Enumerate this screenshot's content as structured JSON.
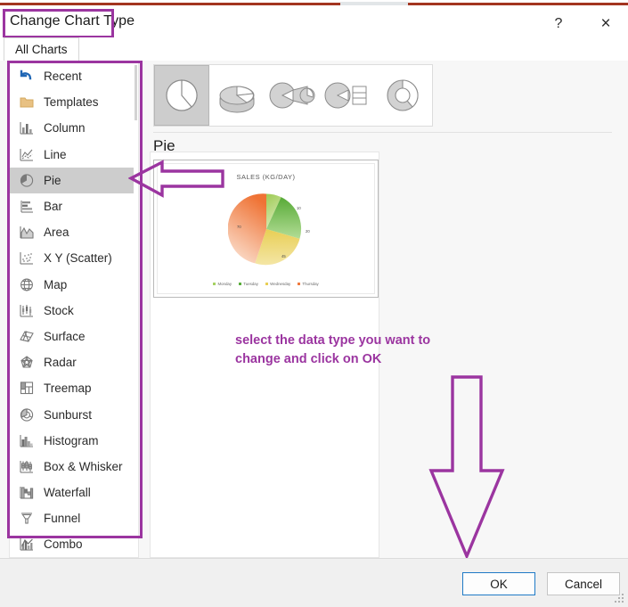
{
  "window": {
    "title": "Change Chart Type",
    "help_label": "?",
    "close_label": "×"
  },
  "tabs": [
    {
      "label": "All Charts",
      "active": true
    }
  ],
  "sidebar": {
    "items": [
      {
        "label": "Recent",
        "icon": "undo-arrow-icon",
        "selected": false
      },
      {
        "label": "Templates",
        "icon": "folder-icon",
        "selected": false
      },
      {
        "label": "Column",
        "icon": "column-chart-icon",
        "selected": false
      },
      {
        "label": "Line",
        "icon": "line-chart-icon",
        "selected": false
      },
      {
        "label": "Pie",
        "icon": "pie-chart-icon",
        "selected": true
      },
      {
        "label": "Bar",
        "icon": "bar-chart-icon",
        "selected": false
      },
      {
        "label": "Area",
        "icon": "area-chart-icon",
        "selected": false
      },
      {
        "label": "X Y (Scatter)",
        "icon": "scatter-chart-icon",
        "selected": false
      },
      {
        "label": "Map",
        "icon": "map-chart-icon",
        "selected": false
      },
      {
        "label": "Stock",
        "icon": "stock-chart-icon",
        "selected": false
      },
      {
        "label": "Surface",
        "icon": "surface-chart-icon",
        "selected": false
      },
      {
        "label": "Radar",
        "icon": "radar-chart-icon",
        "selected": false
      },
      {
        "label": "Treemap",
        "icon": "treemap-chart-icon",
        "selected": false
      },
      {
        "label": "Sunburst",
        "icon": "sunburst-chart-icon",
        "selected": false
      },
      {
        "label": "Histogram",
        "icon": "histogram-chart-icon",
        "selected": false
      },
      {
        "label": "Box & Whisker",
        "icon": "boxplot-chart-icon",
        "selected": false
      },
      {
        "label": "Waterfall",
        "icon": "waterfall-chart-icon",
        "selected": false
      },
      {
        "label": "Funnel",
        "icon": "funnel-chart-icon",
        "selected": false
      },
      {
        "label": "Combo",
        "icon": "combo-chart-icon",
        "selected": false
      }
    ]
  },
  "content": {
    "heading": "Pie",
    "subtypes": [
      {
        "name": "pie-subtype-icon",
        "selected": true
      },
      {
        "name": "pie-3d-subtype-icon",
        "selected": false
      },
      {
        "name": "pie-of-pie-subtype-icon",
        "selected": false
      },
      {
        "name": "bar-of-pie-subtype-icon",
        "selected": false
      },
      {
        "name": "doughnut-subtype-icon",
        "selected": false
      }
    ]
  },
  "annotations": {
    "note": "select the data type you want to change and click on OK",
    "note_line1": "select the data type you want to",
    "note_line2": "change and click on OK",
    "color": "#9b35a0"
  },
  "footer": {
    "ok_label": "OK",
    "cancel_label": "Cancel"
  },
  "chart_data": {
    "type": "pie",
    "title": "SALES (KG/DAY)",
    "categories": [
      "Monday",
      "Tuesday",
      "Wednesday",
      "Thursday"
    ],
    "values": [
      10,
      20,
      45,
      70
    ],
    "labels": [
      "10",
      "20",
      "45",
      "70"
    ],
    "colors": [
      "#a5d161",
      "#5aad3c",
      "#e8cf55",
      "#ef7b3f"
    ],
    "legend_position": "bottom",
    "grid": false,
    "xlabel": "",
    "ylabel": ""
  }
}
